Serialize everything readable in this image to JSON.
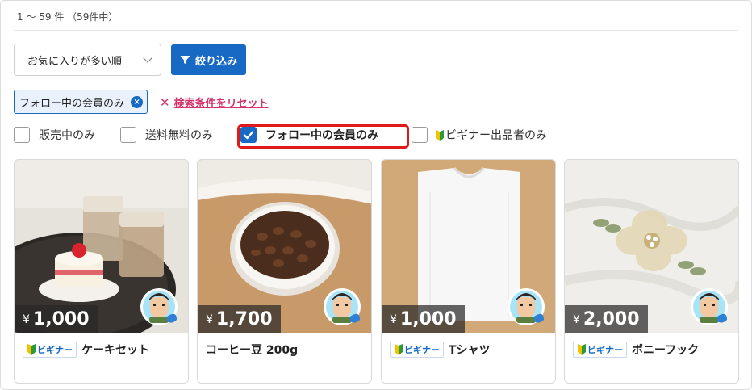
{
  "result_count": "1 〜 59 件 （59件中）",
  "sort": {
    "selected": "お気に入りが多い順"
  },
  "filter_button": {
    "label": "絞り込み"
  },
  "active_filter": {
    "label": "フォロー中の会員のみ"
  },
  "reset_link": {
    "label": "検索条件をリセット"
  },
  "checkboxes": [
    {
      "label": "販売中のみ",
      "checked": false
    },
    {
      "label": "送料無料のみ",
      "checked": false
    },
    {
      "label": "フォロー中の会員のみ",
      "checked": true
    },
    {
      "label": "ビギナー出品者のみ",
      "checked": false,
      "icon": "beginner-leaf-icon"
    }
  ],
  "currency_symbol": "¥",
  "beginner_badge": "ビギナー",
  "products": [
    {
      "price": "1,000",
      "title": "ケーキセット",
      "beginner": true
    },
    {
      "price": "1,700",
      "title": "コーヒー豆 200g",
      "beginner": false
    },
    {
      "price": "1,000",
      "title": "Tシャツ",
      "beginner": true
    },
    {
      "price": "2,000",
      "title": "ポニーフック",
      "beginner": true
    }
  ],
  "colors": {
    "accent": "#1769c4",
    "reset": "#d6336c",
    "highlight": "#e01919"
  }
}
